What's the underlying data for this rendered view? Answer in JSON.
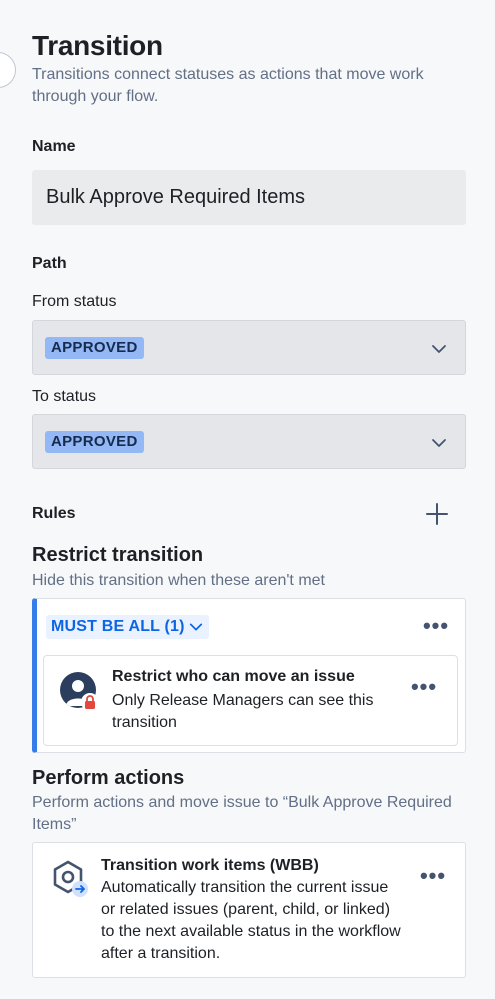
{
  "header": {
    "title": "Transition",
    "subtitle": "Transitions connect statuses as actions that move work through your flow."
  },
  "name_field": {
    "label": "Name",
    "value": "Bulk Approve Required Items"
  },
  "path": {
    "label": "Path",
    "from_label": "From status",
    "from_value": "APPROVED",
    "to_label": "To status",
    "to_value": "APPROVED"
  },
  "rules": {
    "label": "Rules",
    "restrict": {
      "heading": "Restrict transition",
      "description": "Hide this transition when these aren't met",
      "group_label": "MUST BE ALL (1)",
      "card": {
        "title": "Restrict who can move an issue",
        "description": "Only Release Managers can see this transition"
      }
    },
    "actions": {
      "heading": "Perform actions",
      "description": "Perform actions and move issue to “Bulk Approve Required Items”",
      "card": {
        "title": "Transition work items (WBB)",
        "description": "Automatically transition the current issue or related issues (parent, child, or linked) to the next available status in the workflow after a transition."
      }
    }
  },
  "icons": {
    "more": "•••"
  },
  "colors": {
    "accent": "#357de8",
    "lozenge": "#93b8f5",
    "must_be_all_text": "#0c66e4",
    "lock": "#e2483d"
  }
}
